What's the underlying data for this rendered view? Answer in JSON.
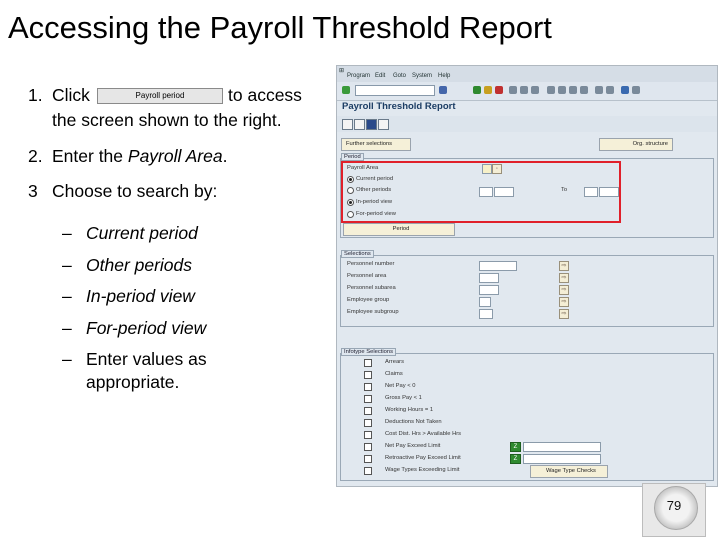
{
  "slide": {
    "title": "Accessing the Payroll Threshold Report",
    "step1": {
      "number": "1.",
      "click": "Click",
      "button_label": "Payroll period",
      "after": "to access",
      "line2": "the screen shown to the right."
    },
    "step2": {
      "number": "2.",
      "text_plain": "Enter the ",
      "text_italic": "Payroll Area",
      "text_end": "."
    },
    "step3": {
      "number": "3",
      "text": "Choose to search by:"
    },
    "bullets": [
      {
        "dash": "–",
        "text": "Current period"
      },
      {
        "dash": "–",
        "text": "Other periods"
      },
      {
        "dash": "–",
        "text": "In-period view"
      },
      {
        "dash": "–",
        "text": "For-period view"
      },
      {
        "dash": "–",
        "text": "Enter values as",
        "text2": "appropriate."
      }
    ],
    "page_number": "79"
  },
  "sap": {
    "menu": [
      "Program",
      "Edit",
      "Goto",
      "System",
      "Help"
    ],
    "screen_title": "Payroll Threshold Report",
    "further_selections": "Further selections",
    "org_structure": "Org. structure",
    "periods": {
      "label": "Period",
      "payroll_area": "Payroll Area",
      "current_period": "Current period",
      "other_periods": "Other periods",
      "to": "To",
      "in_period_view": "In-period view",
      "for_period_view": "For-period view",
      "period_button": "Period"
    },
    "selections": {
      "label": "Selections",
      "fields": [
        "Personnel number",
        "Personnel area",
        "Personnel subarea",
        "Employee group",
        "Employee subgroup"
      ]
    },
    "infotype": {
      "label": "Infotype Selections",
      "items": [
        "Arrears",
        "Claims",
        "Net Pay < 0",
        "Gross Pay < 1",
        "Working Hours = 1",
        "Deductions Not Taken",
        "Cost Dist. Hrs > Available Hrs",
        "Net Pay Exceed Limit",
        "Retroactive Pay Exceed Limit",
        "Wage Types Exceeding Limit"
      ],
      "wage_type_checks": "Wage Type Checks"
    }
  },
  "colors": {
    "highlight": "#e0202a",
    "sap_bg": "#e1e8ef",
    "title_blue": "#1c3d64"
  }
}
